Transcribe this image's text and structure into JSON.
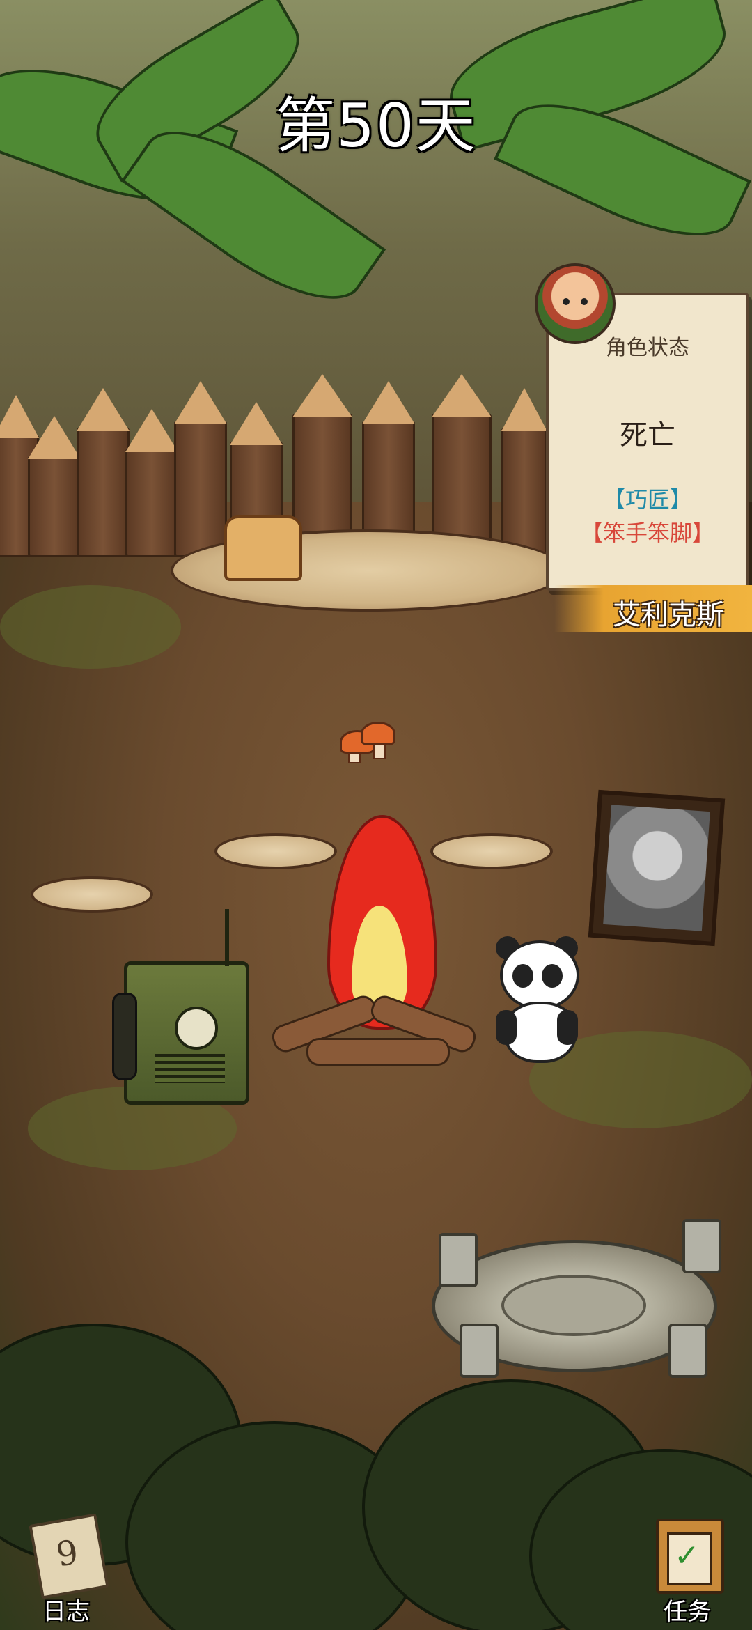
{
  "hud": {
    "day_label": "第50天"
  },
  "character": {
    "status_heading": "角色状态",
    "state": "死亡",
    "trait_primary": "【巧匠】",
    "trait_negative": "【笨手笨脚】",
    "name": "艾利克斯",
    "trait_primary_color": "#1f8aa8",
    "trait_negative_color": "#d8473a"
  },
  "bottom_bar": {
    "journal_label": "日志",
    "journal_icon": "journal-icon",
    "tasks_label": "任务",
    "tasks_icon": "clipboard-check-icon"
  }
}
